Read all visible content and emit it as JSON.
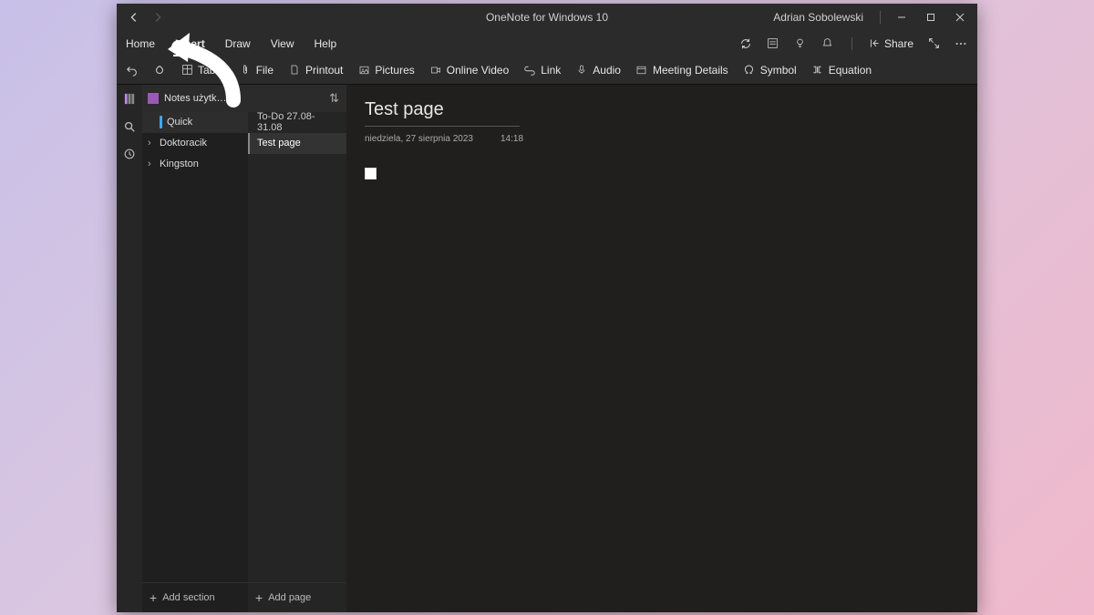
{
  "window": {
    "title": "OneNote for Windows 10",
    "user": "Adrian Sobolewski"
  },
  "menu": {
    "items": [
      "Home",
      "Insert",
      "Draw",
      "View",
      "Help"
    ],
    "active_index": 1,
    "share_label": "Share"
  },
  "ribbon": {
    "table": "Table",
    "file": "File",
    "printout": "Printout",
    "pictures": "Pictures",
    "online_video": "Online Video",
    "link": "Link",
    "audio": "Audio",
    "meeting_details": "Meeting Details",
    "symbol": "Symbol",
    "equation": "Equation"
  },
  "notebook": {
    "name": "Notes użytkownika Adrian"
  },
  "sections": {
    "items": [
      {
        "label": "Quick",
        "color": "#3ea6ff",
        "selected": true,
        "expandable": false
      },
      {
        "label": "Doktoracik",
        "color": null,
        "selected": false,
        "expandable": true
      },
      {
        "label": "Kingston",
        "color": null,
        "selected": false,
        "expandable": true
      }
    ],
    "add_label": "Add section"
  },
  "pages": {
    "items": [
      {
        "label": "To-Do 27.08-31.08",
        "selected": false
      },
      {
        "label": "Test page",
        "selected": true
      }
    ],
    "add_label": "Add page"
  },
  "page": {
    "title": "Test page",
    "date": "niedziela, 27 sierpnia 2023",
    "time": "14:18"
  }
}
